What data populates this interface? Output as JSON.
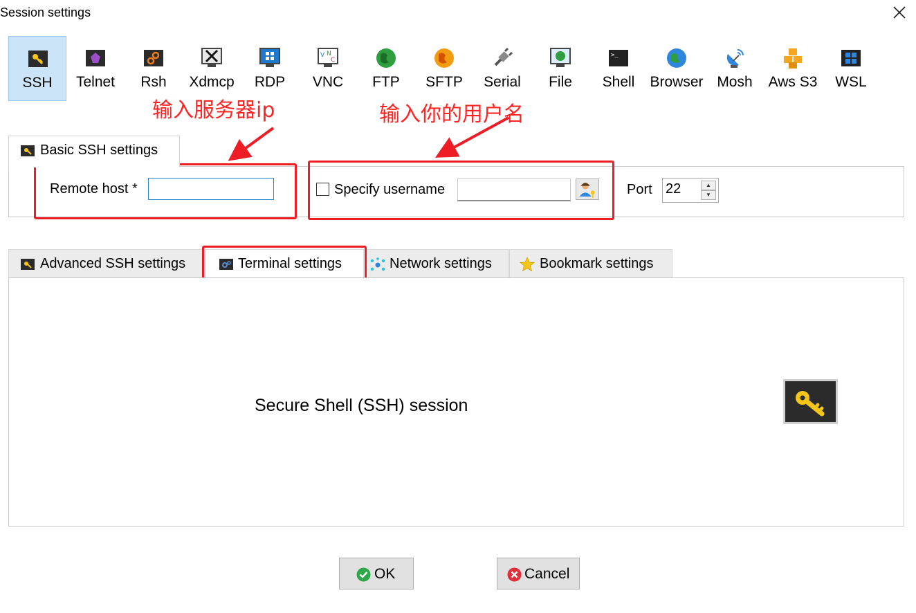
{
  "window": {
    "title": "Session settings"
  },
  "toolbar": {
    "items": [
      {
        "label": "SSH",
        "icon": "key-icon",
        "selected": true
      },
      {
        "label": "Telnet",
        "icon": "gem-icon"
      },
      {
        "label": "Rsh",
        "icon": "gears-icon"
      },
      {
        "label": "Xdmcp",
        "icon": "x-monitor-icon"
      },
      {
        "label": "RDP",
        "icon": "windows-monitor-icon"
      },
      {
        "label": "VNC",
        "icon": "vnc-icon"
      },
      {
        "label": "FTP",
        "icon": "globe-icon"
      },
      {
        "label": "SFTP",
        "icon": "orange-globe-icon"
      },
      {
        "label": "Serial",
        "icon": "plug-icon"
      },
      {
        "label": "File",
        "icon": "file-monitor-icon"
      },
      {
        "label": "Shell",
        "icon": "terminal-icon"
      },
      {
        "label": "Browser",
        "icon": "earth-icon"
      },
      {
        "label": "Mosh",
        "icon": "satellite-icon"
      },
      {
        "label": "Aws S3",
        "icon": "cubes-icon"
      },
      {
        "label": "WSL",
        "icon": "windows-icon"
      }
    ]
  },
  "annotations": {
    "server_ip": "输入服务器ip",
    "username": "输入你的用户名"
  },
  "basic": {
    "tab_label": "Basic SSH settings",
    "remote_host_label": "Remote host *",
    "remote_host_value": "",
    "specify_username_label": "Specify username",
    "specify_username_checked": false,
    "username_value": "",
    "port_label": "Port",
    "port_value": "22"
  },
  "tabs": [
    {
      "label": "Advanced SSH settings",
      "icon": "key-icon"
    },
    {
      "label": "Terminal settings",
      "icon": "terminal-gear-icon"
    },
    {
      "label": "Network settings",
      "icon": "network-icon"
    },
    {
      "label": "Bookmark settings",
      "icon": "star-icon"
    }
  ],
  "panel": {
    "description": "Secure Shell (SSH) session"
  },
  "buttons": {
    "ok": "OK",
    "cancel": "Cancel"
  },
  "colors": {
    "annotation_red": "#ee1c25",
    "selected_bg": "#cce4f7",
    "key_gold": "#f5c518"
  }
}
